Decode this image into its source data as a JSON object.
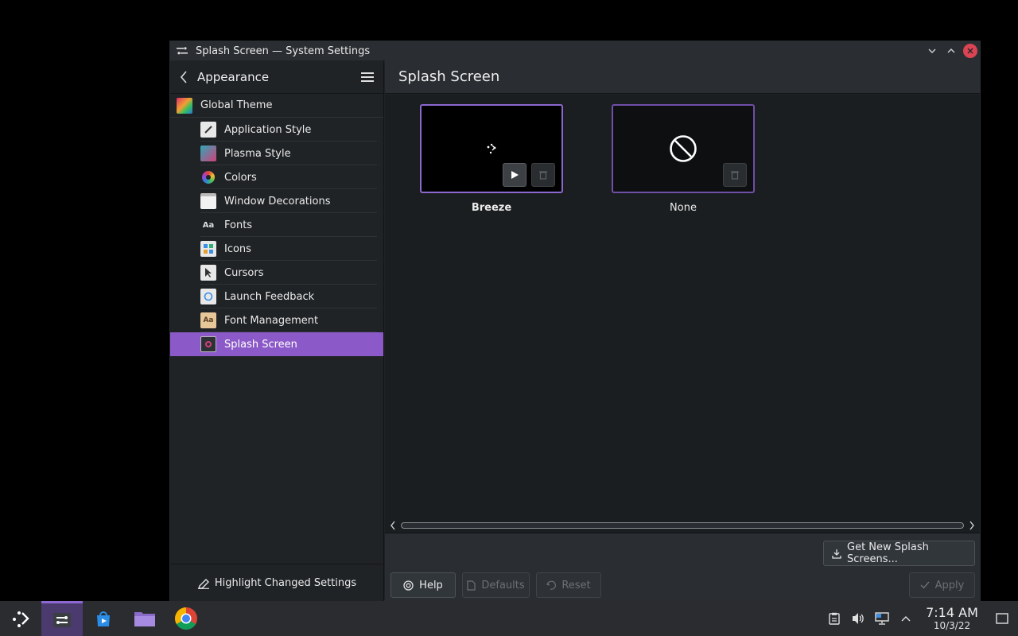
{
  "window": {
    "title": "Splash Screen — System Settings"
  },
  "sidebar": {
    "heading": "Appearance",
    "items": [
      {
        "label": "Global Theme",
        "icon": "global-theme-icon",
        "level": "top"
      },
      {
        "label": "Application Style",
        "icon": "application-style-icon",
        "level": "sub"
      },
      {
        "label": "Plasma Style",
        "icon": "plasma-style-icon",
        "level": "sub"
      },
      {
        "label": "Colors",
        "icon": "colors-icon",
        "level": "sub"
      },
      {
        "label": "Window Decorations",
        "icon": "window-decorations-icon",
        "level": "sub"
      },
      {
        "label": "Fonts",
        "icon": "fonts-icon",
        "level": "sub"
      },
      {
        "label": "Icons",
        "icon": "icons-icon",
        "level": "sub"
      },
      {
        "label": "Cursors",
        "icon": "cursors-icon",
        "level": "sub"
      },
      {
        "label": "Launch Feedback",
        "icon": "launch-feedback-icon",
        "level": "sub"
      },
      {
        "label": "Font Management",
        "icon": "font-management-icon",
        "level": "sub"
      },
      {
        "label": "Splash Screen",
        "icon": "splash-screen-icon",
        "level": "sub",
        "active": true
      }
    ],
    "footer_label": "Highlight Changed Settings"
  },
  "main": {
    "title": "Splash Screen",
    "themes": [
      {
        "name": "Breeze",
        "selected": true
      },
      {
        "name": "None",
        "selected": false
      }
    ],
    "get_new_label": "Get New Splash Screens...",
    "help_label": "Help",
    "defaults_label": "Defaults",
    "reset_label": "Reset",
    "apply_label": "Apply"
  },
  "taskbar": {
    "time": "7:14 AM",
    "date": "10/3/22"
  },
  "colors": {
    "accent": "#8c5ac8",
    "close": "#da4453",
    "background": "#202326"
  }
}
